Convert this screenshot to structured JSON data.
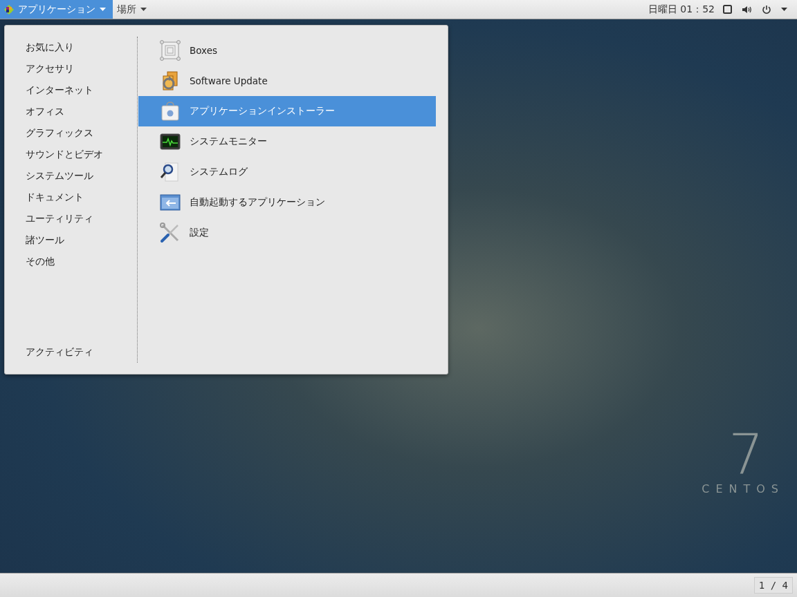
{
  "top_bar": {
    "applications_menu": {
      "label": "アプリケーション",
      "selected": true
    },
    "places_menu": {
      "label": "場所",
      "selected": false
    },
    "clock": "日曜日 01：52"
  },
  "app_menu": {
    "categories": [
      {
        "label": "お気に入り"
      },
      {
        "label": "アクセサリ"
      },
      {
        "label": "インターネット"
      },
      {
        "label": "オフィス"
      },
      {
        "label": "グラフィックス"
      },
      {
        "label": "サウンドとビデオ"
      },
      {
        "label": "システムツール"
      },
      {
        "label": "ドキュメント"
      },
      {
        "label": "ユーティリティ"
      },
      {
        "label": "諸ツール"
      },
      {
        "label": "その他"
      }
    ],
    "activities": "アクティビティ",
    "apps": [
      {
        "label": "Boxes",
        "kind": "boxes",
        "selected": false
      },
      {
        "label": "Software Update",
        "kind": "update",
        "selected": false
      },
      {
        "label": "アプリケーションインストーラー",
        "kind": "installer",
        "selected": true
      },
      {
        "label": "システムモニター",
        "kind": "monitor",
        "selected": false
      },
      {
        "label": "システムログ",
        "kind": "log",
        "selected": false
      },
      {
        "label": "自動起動するアプリケーション",
        "kind": "autostart",
        "selected": false
      },
      {
        "label": "設定",
        "kind": "settings",
        "selected": false
      }
    ]
  },
  "wallpaper": {
    "version": "7",
    "brand": "CENTOS"
  },
  "bottom_bar": {
    "workspace": "1 / 4"
  }
}
